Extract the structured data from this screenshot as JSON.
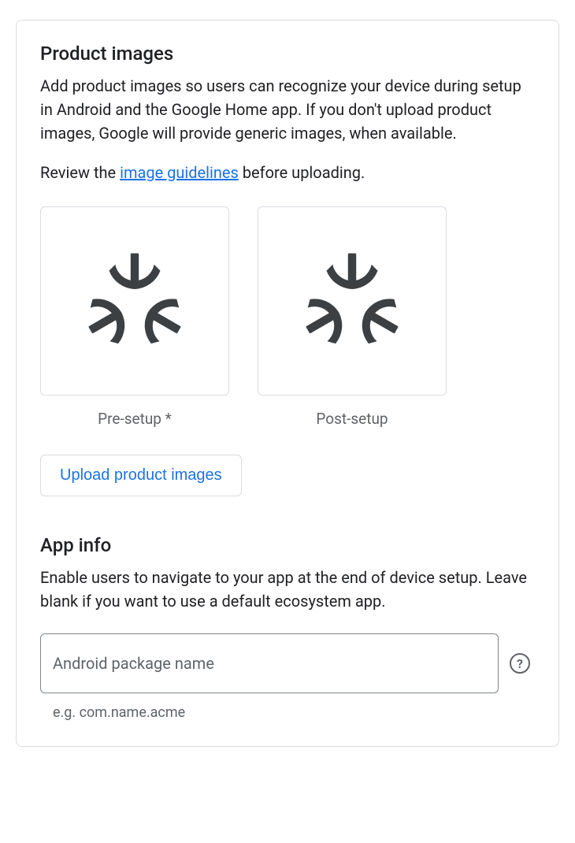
{
  "productImages": {
    "title": "Product images",
    "description": "Add product images so users can recognize your device during setup in Android and the Google Home app. If you don't upload product images, Google will provide generic images, when available.",
    "review_prefix": "Review the ",
    "review_link": "image guidelines",
    "review_suffix": " before uploading.",
    "pre_setup_label": "Pre-setup *",
    "post_setup_label": "Post-setup",
    "upload_button": "Upload product images"
  },
  "appInfo": {
    "title": "App info",
    "description": "Enable users to navigate to your app at the end of device setup. Leave blank if you want to use a default ecosystem app.",
    "package_label": "Android package name",
    "package_value": "",
    "package_hint": "e.g. com.name.acme",
    "help_glyph": "?"
  }
}
